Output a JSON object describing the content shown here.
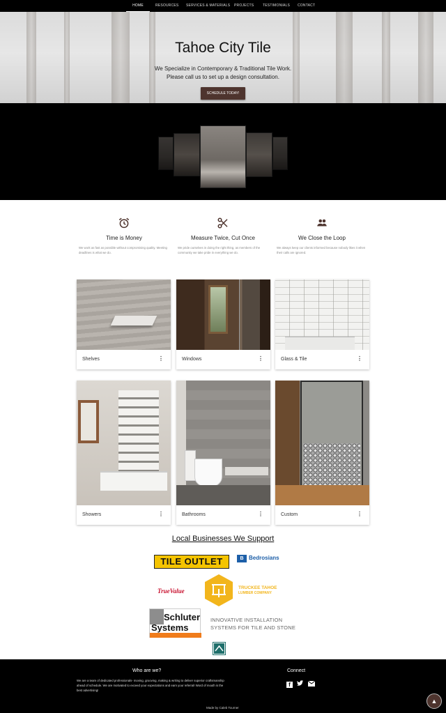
{
  "nav": {
    "items": [
      "HOME",
      "RESOURCES",
      "SERVICES & MATERIALS",
      "PROJECTS",
      "TESTIMONIALS",
      "CONTACT"
    ],
    "active": "HOME"
  },
  "hero": {
    "title": "Tahoe City Tile",
    "line1": "We Specialize in Contemporary & Traditional Tile Work.",
    "line2": "Please call us to set up a design consultation.",
    "button": "SCHEDULE TODAY!"
  },
  "features": [
    {
      "icon": "alarm-clock-icon",
      "title": "Time is Money",
      "text": "We work as fast as possible without compromising quality. Meeting deadlines is what we do."
    },
    {
      "icon": "scissors-icon",
      "title": "Measure Twice, Cut Once",
      "text": "We pride ourselves in doing the right thing, as members of the community we take pride in everything we do."
    },
    {
      "icon": "group-icon",
      "title": "We Close the Loop",
      "text": "We always keep our clients informed because nobody likes it when their calls are ignored."
    }
  ],
  "cards": [
    {
      "label": "Shelves",
      "menu": "⋮"
    },
    {
      "label": "Windows",
      "menu": "⋮"
    },
    {
      "label": "Glass & Tile",
      "menu": "⋮"
    },
    {
      "label": "Showers",
      "menu": "⋮"
    },
    {
      "label": "Bathrooms",
      "menu": "⋮"
    },
    {
      "label": "Custom",
      "menu": "⋮"
    }
  ],
  "businesses": {
    "title": "Local Businesses We Support",
    "tile_outlet": "TILE OUTLET",
    "bedrosians": "Bedrosians",
    "true_value": "TrueValue",
    "truckee_line1": "TRUCKEE TAHOE",
    "truckee_line2": "LUMBER COMPANY",
    "schluter_line1": "Schluter",
    "schluter_line2": "Systems",
    "schluter_tag1": "INNOVATIVE INSTALLATION",
    "schluter_tag2": "SYSTEMS FOR TILE AND STONE"
  },
  "footer": {
    "who_title": "Who are we?",
    "who_text": "We are a team of dedicated professionals- moving, grooving, making & writing to deliver superior craftsmanship ahead of schedule. We are motivated to exceed your expectations and earn your referral! Word of mouth is the best advertising!",
    "connect_title": "Connect",
    "made_by": "Made by Caleb Tourner"
  },
  "colors": {
    "brand": "#4e342e",
    "footer": "#000000"
  }
}
